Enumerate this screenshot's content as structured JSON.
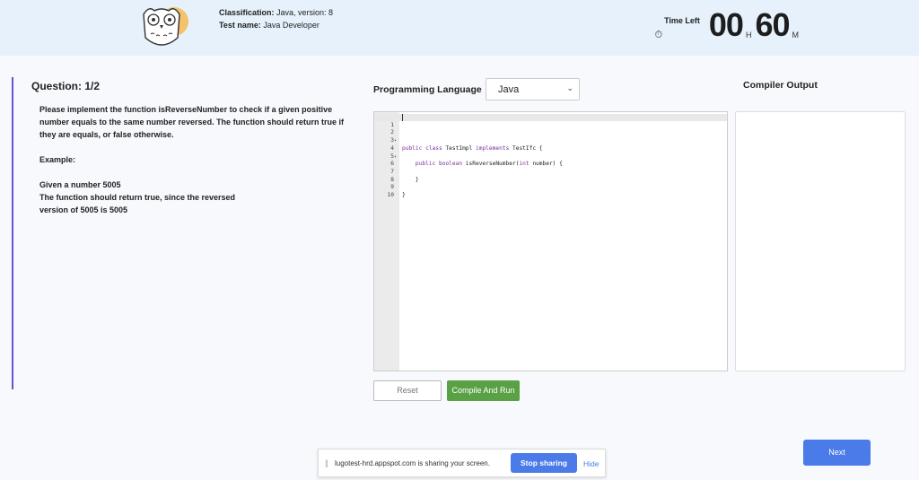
{
  "header": {
    "classification_label": "Classification:",
    "classification_value": "Java, version: 8",
    "testname_label": "Test name:",
    "testname_value": "Java Developer",
    "logo_icon": "owl-icon",
    "time_left_label": "Time Left",
    "clock_icon": "stopwatch-icon",
    "hours": "00",
    "hours_unit": "H",
    "minutes": "60",
    "minutes_unit": "M"
  },
  "question": {
    "title": "Question: 1/2",
    "text_1": "Please implement the function isReverseNumber to check if a given positive number equals to the same number reversed. The function should return true if they are equals, or false otherwise.",
    "example_label": "Example:",
    "example_line_1": "Given a number 5005",
    "example_line_2": "The function should return true, since the reversed",
    "example_line_3": "version of 5005 is 5005"
  },
  "editor": {
    "language_label": "Programming Language",
    "language_selected": "Java",
    "lines": [
      "",
      "public class TestImpl implements TestIfc {",
      "",
      "    public boolean isReverseNumber(int number) {",
      "",
      "",
      "    }",
      "",
      "}",
      ""
    ],
    "line_numbers": [
      "1",
      "2",
      "3",
      "4",
      "5",
      "6",
      "7",
      "8",
      "9",
      "10"
    ]
  },
  "output": {
    "title": "Compiler Output"
  },
  "buttons": {
    "reset": "Reset",
    "compile_run": "Compile And Run",
    "next": "Next"
  },
  "share_bar": {
    "text": "lugotest-hrd.appspot.com is sharing your screen.",
    "stop": "Stop sharing",
    "hide": "Hide"
  },
  "colors": {
    "header_bg": "#e6f1fb",
    "accent_bar": "#5f55d6",
    "run_green": "#5aa146",
    "next_blue": "#4a7be8"
  }
}
